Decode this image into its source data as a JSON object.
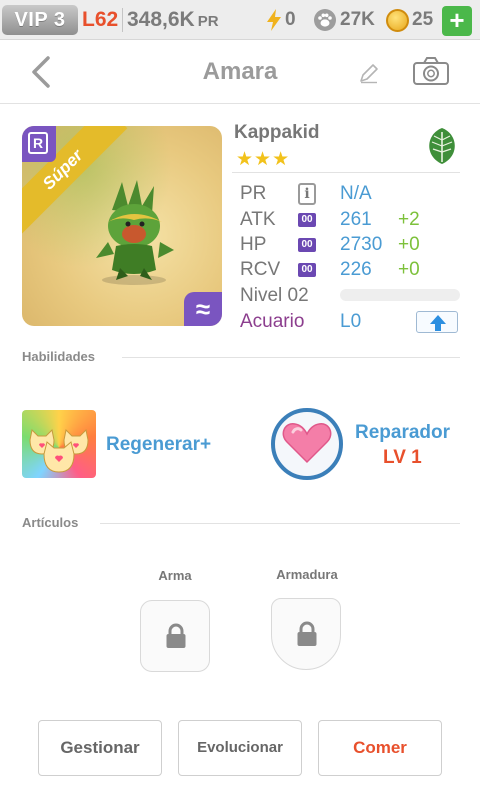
{
  "status_bar": {
    "vip": "VIP 3",
    "level": "L62",
    "power": "348,6K",
    "power_unit": "PR",
    "energy": "0",
    "paws": "27K",
    "coins": "25",
    "plus": "+"
  },
  "header": {
    "title": "Amara"
  },
  "pet": {
    "rarity_letter": "R",
    "ribbon": "Súper",
    "element_symbol": "≈",
    "name": "Kappakid",
    "stars": "★★★",
    "star_count": 3,
    "element_icon": "leaf-icon",
    "stats": [
      {
        "key": "PR",
        "value": "N/A",
        "bonus": ""
      },
      {
        "key": "ATK",
        "chip": "00",
        "value": "261",
        "bonus": "+2"
      },
      {
        "key": "HP",
        "chip": "00",
        "value": "2730",
        "bonus": "+0"
      },
      {
        "key": "RCV",
        "chip": "00",
        "value": "226",
        "bonus": "+0"
      }
    ],
    "level_label": "Nivel 02",
    "level_progress": 0,
    "aquarium_label": "Acuario",
    "aquarium_value": "L0"
  },
  "abilities": {
    "heading": "Habilidades",
    "skill1": {
      "name": "Regenerar+",
      "icon": "cat-faces-icon"
    },
    "skill2": {
      "name": "Reparador",
      "level": "LV 1",
      "icon": "heart-icon"
    }
  },
  "items": {
    "heading": "Artículos",
    "weapon_label": "Arma",
    "armor_label": "Armadura"
  },
  "actions": {
    "manage": "Gestionar",
    "evolve": "Evolucionar",
    "eat": "Comer"
  },
  "colors": {
    "accent_blue": "#4a9bd3",
    "accent_orange": "#e8502c",
    "accent_green": "#7dc13b",
    "badge_purple": "#7a55c0"
  }
}
